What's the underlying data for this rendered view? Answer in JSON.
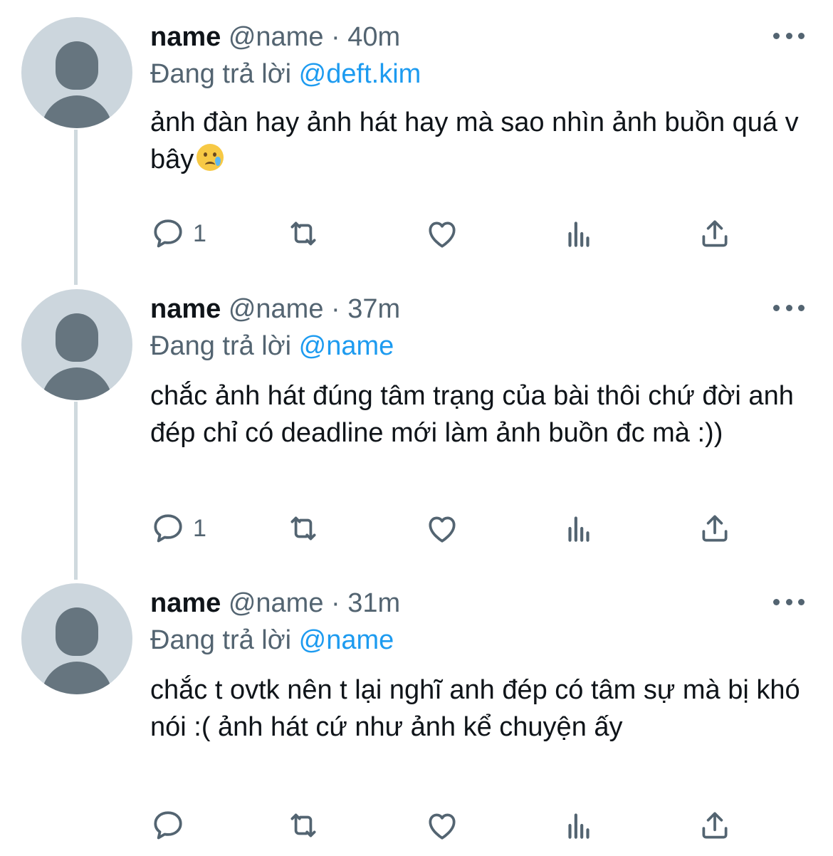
{
  "colors": {
    "text": "#0f1419",
    "secondary": "#536471",
    "mention": "#1d9bf0",
    "thread_line": "#cfd9de",
    "avatar_bg": "#ccd6dd",
    "avatar_fg": "#66757f"
  },
  "tweets": [
    {
      "name": "name",
      "handle": "@name",
      "separator": "·",
      "time": "40m",
      "reply_prefix": "Đang trả lời",
      "reply_to": "@deft.kim",
      "text": "ảnh đàn hay ảnh hát hay mà sao nhìn ảnh buồn quá v bây",
      "emoji": "crying-face-icon",
      "reply_count": "1"
    },
    {
      "name": "name",
      "handle": "@name",
      "separator": "·",
      "time": "37m",
      "reply_prefix": "Đang trả lời",
      "reply_to": "@name",
      "text": "chắc ảnh hát đúng tâm trạng của bài thôi chứ đời anh đép chỉ có deadline mới làm ảnh buồn đc mà :))",
      "reply_count": "1"
    },
    {
      "name": "name",
      "handle": "@name",
      "separator": "·",
      "time": "31m",
      "reply_prefix": "Đang trả lời",
      "reply_to": "@name",
      "text": "chắc t ovtk nên t lại nghĩ anh đép có tâm sự mà bị khó nói :( ảnh hát cứ như ảnh kể chuyện ấy",
      "reply_count": ""
    }
  ]
}
